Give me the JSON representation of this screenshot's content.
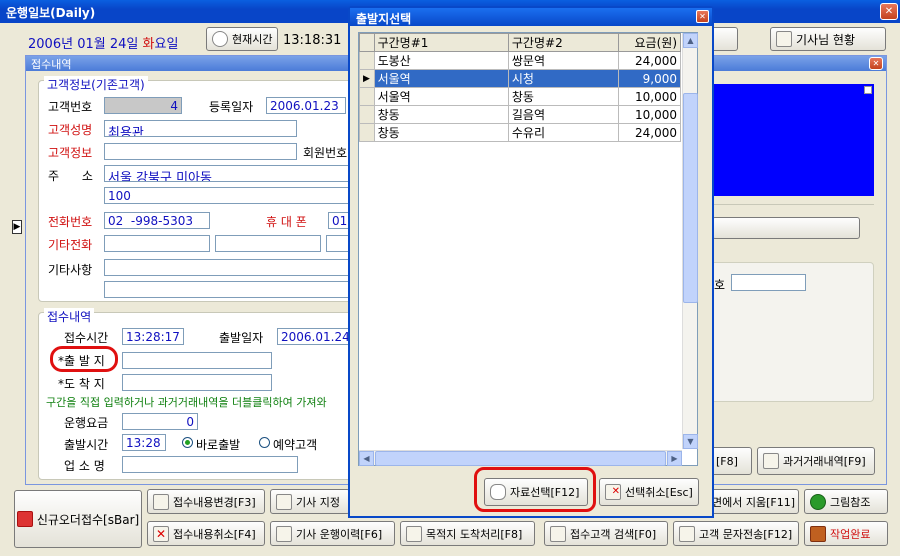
{
  "window": {
    "title": "운행일보(Daily)"
  },
  "header": {
    "year": "2006",
    "year_suffix": "년",
    "month": "01",
    "month_suffix": "월",
    "day": "24",
    "day_suffix": "일",
    "weekday": "화",
    "weekday_suffix": "요일",
    "current_time_button": "현재시간",
    "time": "13:18:31",
    "driver_status_button": "기사님 현황"
  },
  "reception_panel": {
    "title": "접수내역"
  },
  "customer": {
    "group_title": "고객정보(기존고객)",
    "id_label": "고객번호",
    "id_value": "4",
    "reg_date_label": "등록일자",
    "reg_date_value": "2006.01.23",
    "name_label": "고객성명",
    "name_value": "최용관",
    "info_label": "고객정보",
    "info_value": "",
    "member_no_label": "회원번호",
    "address_label": "주      소",
    "address_line1": "서울 강북구 미아동",
    "address_line2": "100",
    "phone_label": "전화번호",
    "phone_value": "02  -998-5303",
    "mobile_label": "휴 대 폰",
    "mobile_value": "01",
    "other_phone_label": "기타전화",
    "notes_label": "기타사항"
  },
  "reception": {
    "group_title": "접수내역",
    "time_label": "접수시간",
    "time_value": "13:28:17",
    "depart_date_label": "출발일자",
    "depart_date_value": "2006.01.24",
    "origin_label": "*출 발 지",
    "origin_value": "",
    "destination_label": "*도 착 지",
    "destination_value": "",
    "hint": "구간을 직접 입력하거나 과거거래내역을 더블클릭하여 가져와",
    "fare_label": "운행요금",
    "fare_value": "0",
    "depart_time_label": "출발시간",
    "depart_time_value": "13:28",
    "radio_now": "바로출발",
    "radio_reserve": "예약고객",
    "company_label": "업 소 명"
  },
  "right_panel": {
    "ho_label": "호",
    "f8_label": "[F8]",
    "history_button": "과거거래내역[F9]"
  },
  "dialog": {
    "title": "출발지선택",
    "columns": [
      "구간명#1",
      "구간명#2",
      "요금(원)"
    ],
    "rows": [
      {
        "a": "도봉산",
        "b": "쌍문역",
        "fare": "24,000"
      },
      {
        "a": "서울역",
        "b": "시청",
        "fare": "9,000",
        "selected": true
      },
      {
        "a": "서울역",
        "b": "창동",
        "fare": "10,000"
      },
      {
        "a": "창동",
        "b": "길음역",
        "fare": "10,000"
      },
      {
        "a": "창동",
        "b": "수유리",
        "fare": "24,000"
      }
    ],
    "select_button": "자료선택[F12]",
    "cancel_button": "선택취소[Esc]"
  },
  "toolbar": {
    "new_order": "신규오더접수[sBar]",
    "change": "접수내용변경[F3]",
    "assign_driver": "기사 지정",
    "cancel": "접수내용취소[F4]",
    "driver_history": "기사 운행이력[F6]",
    "arrival": "목적지 도착처리[F8]",
    "search_customer": "접수고객 검색[F0]",
    "sms": "고객 문자전송[F12]",
    "erase": "면에서 지움[F11]",
    "picture": "그림참조",
    "complete": "작업완료"
  },
  "colors": {
    "title_bar": "#0845c8",
    "highlight": "#316ac5",
    "blue_box": "#0000ff",
    "annotation": "#e01010"
  }
}
